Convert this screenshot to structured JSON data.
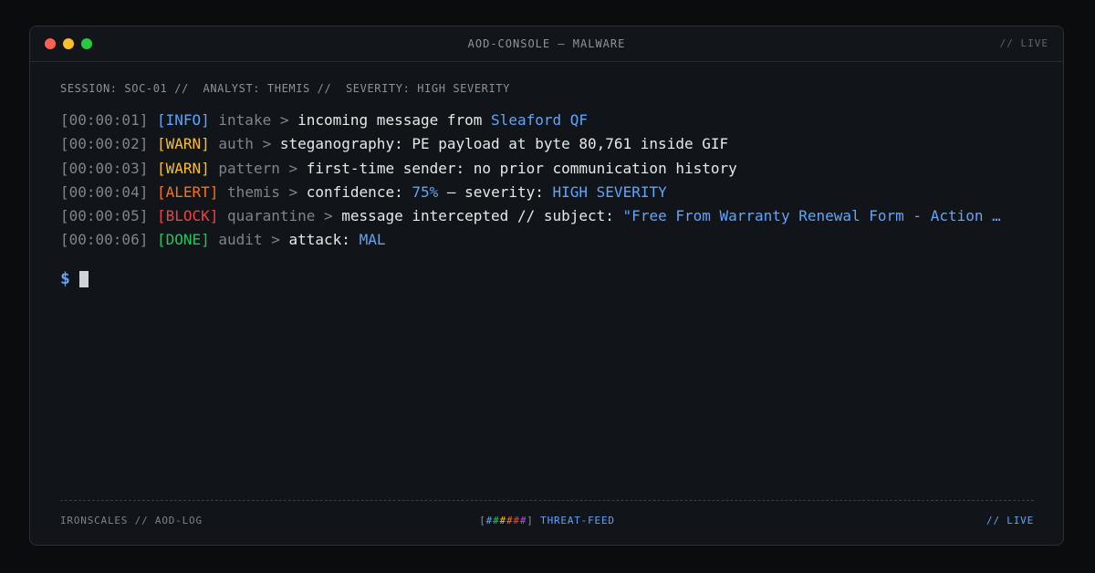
{
  "window": {
    "title": "AOD-CONSOLE — MALWARE",
    "status": "// LIVE",
    "controls": [
      {
        "name": "close",
        "color": "#ff5f57"
      },
      {
        "name": "minimize",
        "color": "#febc2e"
      },
      {
        "name": "maximize",
        "color": "#28c840"
      }
    ]
  },
  "session_line": "SESSION: SOC-01 //  ANALYST: THEMIS //  SEVERITY: HIGH SEVERITY",
  "colors": {
    "info": "#60a5fa",
    "warn": "#fbbf24",
    "alert": "#f97316",
    "block": "#ef4444",
    "done": "#22c55e",
    "highlight": "#60a5fa"
  },
  "log": [
    {
      "ts": "[00:00:01]",
      "level": "[INFO]",
      "level_color": "#60a5fa",
      "source": "intake >",
      "message": "incoming message from",
      "highlight": "Sleaford QF",
      "tail": ""
    },
    {
      "ts": "[00:00:02]",
      "level": "[WARN]",
      "level_color": "#fbbf24",
      "source": "auth >",
      "message": "steganography: PE payload at byte 80,761 inside GIF",
      "highlight": "",
      "tail": ""
    },
    {
      "ts": "[00:00:03]",
      "level": "[WARN]",
      "level_color": "#fbbf24",
      "source": "pattern >",
      "message": "first-time sender: no prior communication history",
      "highlight": "",
      "tail": ""
    },
    {
      "ts": "[00:00:04]",
      "level": "[ALERT]",
      "level_color": "#f97316",
      "source": "themis >",
      "message": "confidence:",
      "highlight": "75%",
      "tail": " — severity: ",
      "highlight2": "HIGH SEVERITY"
    },
    {
      "ts": "[00:00:05]",
      "level": "[BLOCK]",
      "level_color": "#ef4444",
      "source": "quarantine >",
      "message": "message intercepted // subject:",
      "highlight": "\"Free From Warranty Renewal Form - Action …",
      "tail": ""
    },
    {
      "ts": "[00:00:06]",
      "level": "[DONE]",
      "level_color": "#22c55e",
      "source": "audit >",
      "message": "attack:",
      "highlight": "MAL",
      "tail": ""
    }
  ],
  "prompt": {
    "symbol": "$"
  },
  "footer": {
    "left": "IRONSCALES // AOD-LOG",
    "feed_open": "[",
    "feed_bar": [
      {
        "char": "#",
        "color": "#60a5fa"
      },
      {
        "char": "#",
        "color": "#22c55e"
      },
      {
        "char": "#",
        "color": "#fbbf24"
      },
      {
        "char": "#",
        "color": "#f97316"
      },
      {
        "char": "#",
        "color": "#ef4444"
      },
      {
        "char": "#",
        "color": "#a855f7"
      }
    ],
    "feed_close": "]",
    "feed_label": "THREAT-FEED",
    "right": "// LIVE"
  }
}
